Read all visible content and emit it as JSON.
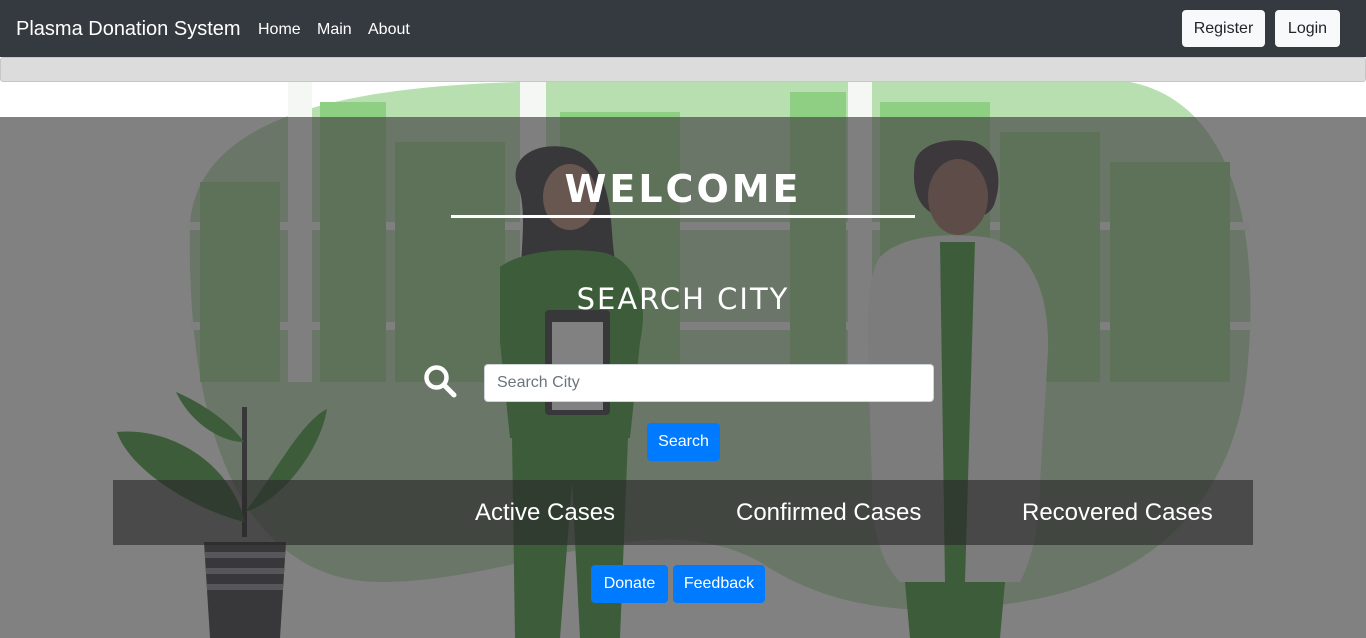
{
  "navbar": {
    "brand": "Plasma Donation System",
    "links": [
      "Home",
      "Main",
      "About"
    ],
    "register_label": "Register",
    "login_label": "Login"
  },
  "hero": {
    "welcome": "WELCOME",
    "search_title": "SEARCH CITY",
    "search": {
      "placeholder": "Search City",
      "value": "",
      "button_label": "Search"
    },
    "stats": {
      "active_label": "Active Cases",
      "confirmed_label": "Confirmed Cases",
      "recovered_label": "Recovered Cases"
    },
    "donate_label": "Donate",
    "feedback_label": "Feedback"
  },
  "icons": {
    "search": "search-icon",
    "background": "doctors-illustration"
  },
  "colors": {
    "navbar": "#343a40",
    "primary_button": "#007bff",
    "light_button": "#f8f9fa",
    "illustration_green": "#2e8b22"
  }
}
